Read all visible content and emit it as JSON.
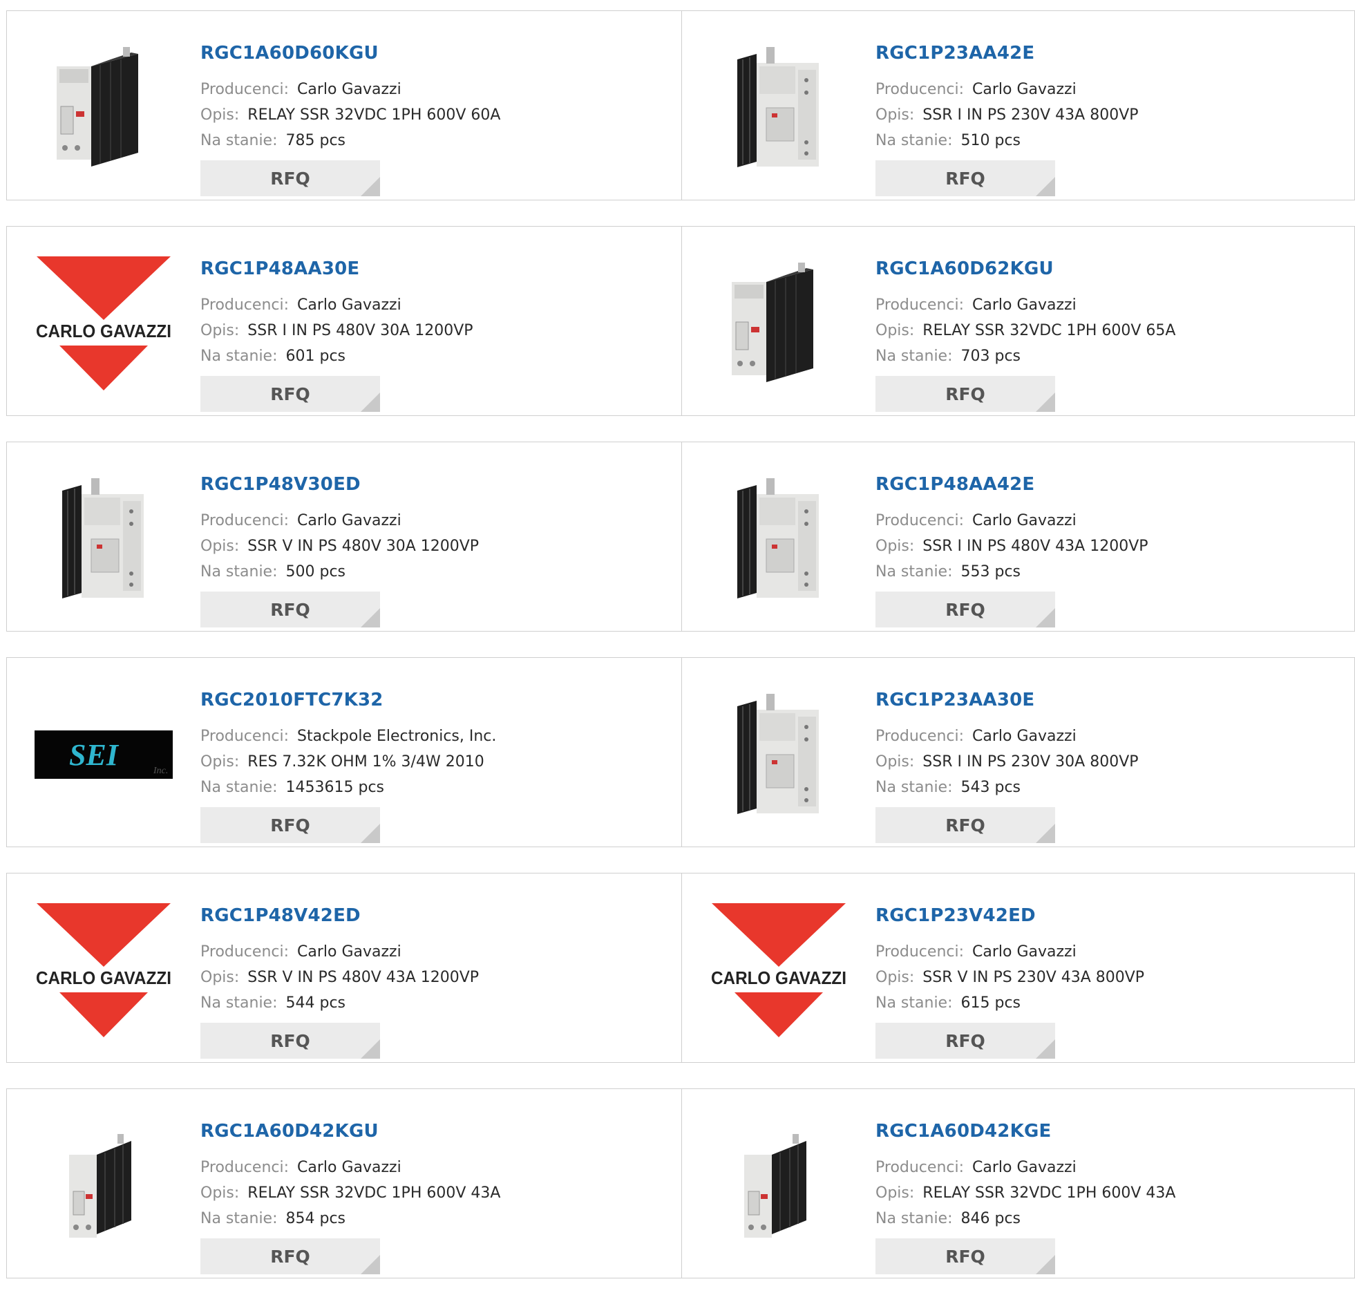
{
  "labels": {
    "manufacturer": "Producenci:",
    "description": "Opis:",
    "stock": "Na stanie:"
  },
  "rfq_label": "RFQ",
  "products": [
    {
      "part_number": "RGC1A60D60KGU",
      "manufacturer": "Carlo Gavazzi",
      "description": "RELAY SSR 32VDC 1PH 600V 60A",
      "stock": "785 pcs",
      "image": "relay-wide-heatsink"
    },
    {
      "part_number": "RGC1P23AA42E",
      "manufacturer": "Carlo Gavazzi",
      "description": "SSR I IN PS 230V 43A 800VP",
      "stock": "510 pcs",
      "image": "relay-tall"
    },
    {
      "part_number": "RGC1P48AA30E",
      "manufacturer": "Carlo Gavazzi",
      "description": "SSR I IN PS 480V 30A 1200VP",
      "stock": "601 pcs",
      "image": "carlo-gavazzi-logo",
      "logo_text": "CARLO GAVAZZI"
    },
    {
      "part_number": "RGC1A60D62KGU",
      "manufacturer": "Carlo Gavazzi",
      "description": "RELAY SSR 32VDC 1PH 600V 65A",
      "stock": "703 pcs",
      "image": "relay-wide-heatsink"
    },
    {
      "part_number": "RGC1P48V30ED",
      "manufacturer": "Carlo Gavazzi",
      "description": "SSR V IN PS 480V 30A 1200VP",
      "stock": "500 pcs",
      "image": "relay-tall"
    },
    {
      "part_number": "RGC1P48AA42E",
      "manufacturer": "Carlo Gavazzi",
      "description": "SSR I IN PS 480V 43A 1200VP",
      "stock": "553 pcs",
      "image": "relay-tall"
    },
    {
      "part_number": "RGC2010FTC7K32",
      "manufacturer": "Stackpole Electronics, Inc.",
      "description": "RES 7.32K OHM 1% 3/4W 2010",
      "stock": "1453615 pcs",
      "image": "sei-logo",
      "logo_text": "SEI",
      "logo_sub": "Inc."
    },
    {
      "part_number": "RGC1P23AA30E",
      "manufacturer": "Carlo Gavazzi",
      "description": "SSR I IN PS 230V 30A 800VP",
      "stock": "543 pcs",
      "image": "relay-tall"
    },
    {
      "part_number": "RGC1P48V42ED",
      "manufacturer": "Carlo Gavazzi",
      "description": "SSR V IN PS 480V 43A 1200VP",
      "stock": "544 pcs",
      "image": "carlo-gavazzi-logo",
      "logo_text": "CARLO GAVAZZI"
    },
    {
      "part_number": "RGC1P23V42ED",
      "manufacturer": "Carlo Gavazzi",
      "description": "SSR V IN PS 230V 43A 800VP",
      "stock": "615 pcs",
      "image": "carlo-gavazzi-logo",
      "logo_text": "CARLO GAVAZZI"
    },
    {
      "part_number": "RGC1A60D42KGU",
      "manufacturer": "Carlo Gavazzi",
      "description": "RELAY SSR 32VDC 1PH 600V 43A",
      "stock": "854 pcs",
      "image": "relay-small"
    },
    {
      "part_number": "RGC1A60D42KGE",
      "manufacturer": "Carlo Gavazzi",
      "description": "RELAY SSR 32VDC 1PH 600V 43A",
      "stock": "846 pcs",
      "image": "relay-small"
    }
  ],
  "colors": {
    "link": "#1e65a8",
    "label": "#8c8c8c",
    "button_bg": "#ebebeb",
    "logo_red": "#e8372c"
  }
}
